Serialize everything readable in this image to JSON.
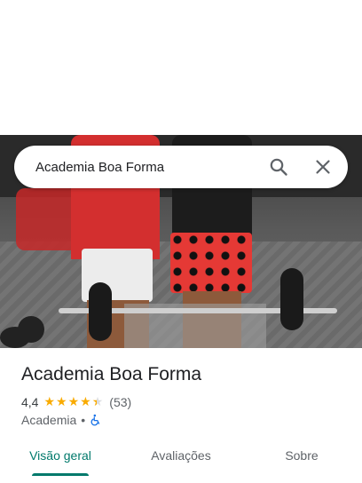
{
  "search": {
    "query": "Academia Boa Forma",
    "icons": {
      "search": "search-icon",
      "close": "close-icon"
    }
  },
  "place": {
    "name": "Academia Boa Forma",
    "rating": "4,4",
    "stars": 4.4,
    "reviews": "(53)",
    "category": "Academia",
    "separator": "•",
    "accessibility_icon": "wheelchair-icon"
  },
  "tabs": [
    {
      "label": "Visão geral",
      "active": true
    },
    {
      "label": "Avaliações",
      "active": false
    },
    {
      "label": "Sobre",
      "active": false
    }
  ],
  "colors": {
    "accent": "#00796b",
    "star": "#f9ab00",
    "accessibility": "#1a73e8"
  }
}
